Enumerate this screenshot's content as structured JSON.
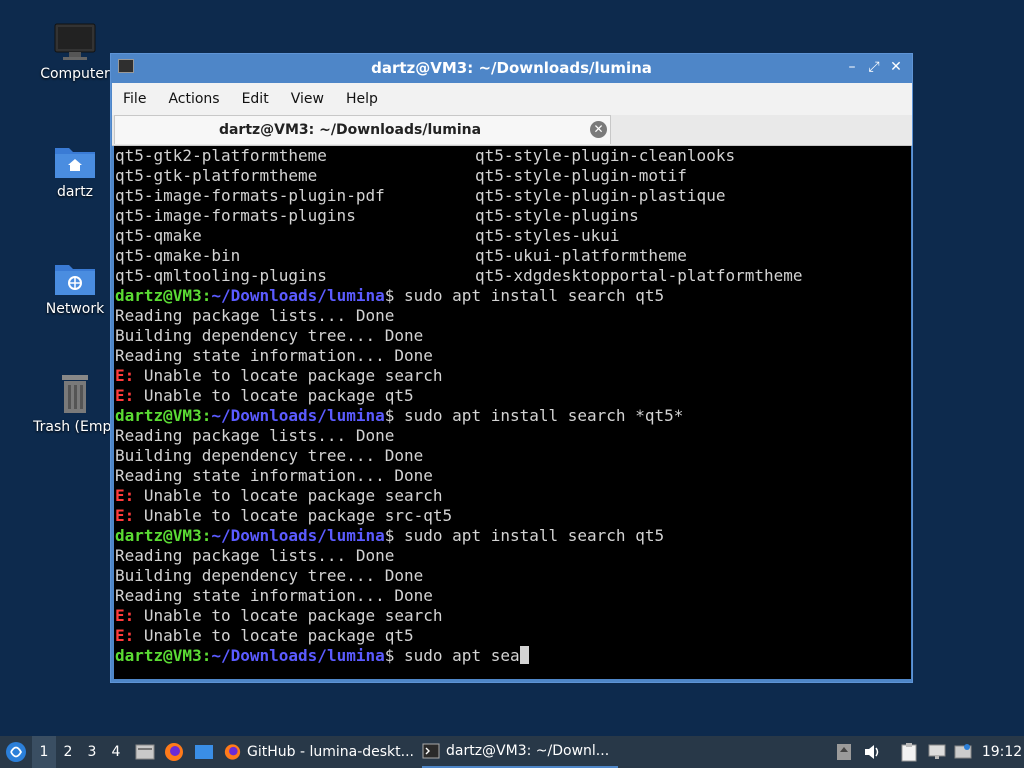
{
  "desktop": {
    "icons": [
      {
        "label": "Computer"
      },
      {
        "label": "dartz"
      },
      {
        "label": "Network"
      },
      {
        "label": "Trash (Empt"
      }
    ]
  },
  "window": {
    "title": "dartz@VM3: ~/Downloads/lumina",
    "menu": [
      "File",
      "Actions",
      "Edit",
      "View",
      "Help"
    ],
    "tab_title": "dartz@VM3: ~/Downloads/lumina"
  },
  "terminal": {
    "columns": [
      [
        "qt5-gtk2-platformtheme",
        "qt5-style-plugin-cleanlooks"
      ],
      [
        "qt5-gtk-platformtheme",
        "qt5-style-plugin-motif"
      ],
      [
        "qt5-image-formats-plugin-pdf",
        "qt5-style-plugin-plastique"
      ],
      [
        "qt5-image-formats-plugins",
        "qt5-style-plugins"
      ],
      [
        "qt5-qmake",
        "qt5-styles-ukui"
      ],
      [
        "qt5-qmake-bin",
        "qt5-ukui-platformtheme"
      ],
      [
        "qt5-qmltooling-plugins",
        "qt5-xdgdesktopportal-platformtheme"
      ]
    ],
    "prompt_user": "dartz@VM3",
    "prompt_sep": ":",
    "prompt_path": "~/Downloads/lumina",
    "prompt_dollar": "$",
    "err_prefix": "E:",
    "blocks": [
      {
        "cmd": " sudo apt install search qt5",
        "out": [
          "Reading package lists... Done",
          "Building dependency tree... Done",
          "Reading state information... Done"
        ],
        "errs": [
          " Unable to locate package search",
          " Unable to locate package qt5"
        ]
      },
      {
        "cmd": " sudo apt install search *qt5*",
        "out": [
          "Reading package lists... Done",
          "Building dependency tree... Done",
          "Reading state information... Done"
        ],
        "errs": [
          " Unable to locate package search",
          " Unable to locate package src-qt5"
        ]
      },
      {
        "cmd": " sudo apt install search qt5",
        "out": [
          "Reading package lists... Done",
          "Building dependency tree... Done",
          "Reading state information... Done"
        ],
        "errs": [
          " Unable to locate package search",
          " Unable to locate package qt5"
        ]
      }
    ],
    "current_input": " sudo apt sea"
  },
  "taskbar": {
    "workspaces": [
      "1",
      "2",
      "3",
      "4"
    ],
    "active_workspace": "1",
    "tasks": [
      {
        "label": "GitHub - lumina-deskt..."
      },
      {
        "label": "dartz@VM3: ~/Downl..."
      }
    ],
    "clock": "19:12"
  }
}
